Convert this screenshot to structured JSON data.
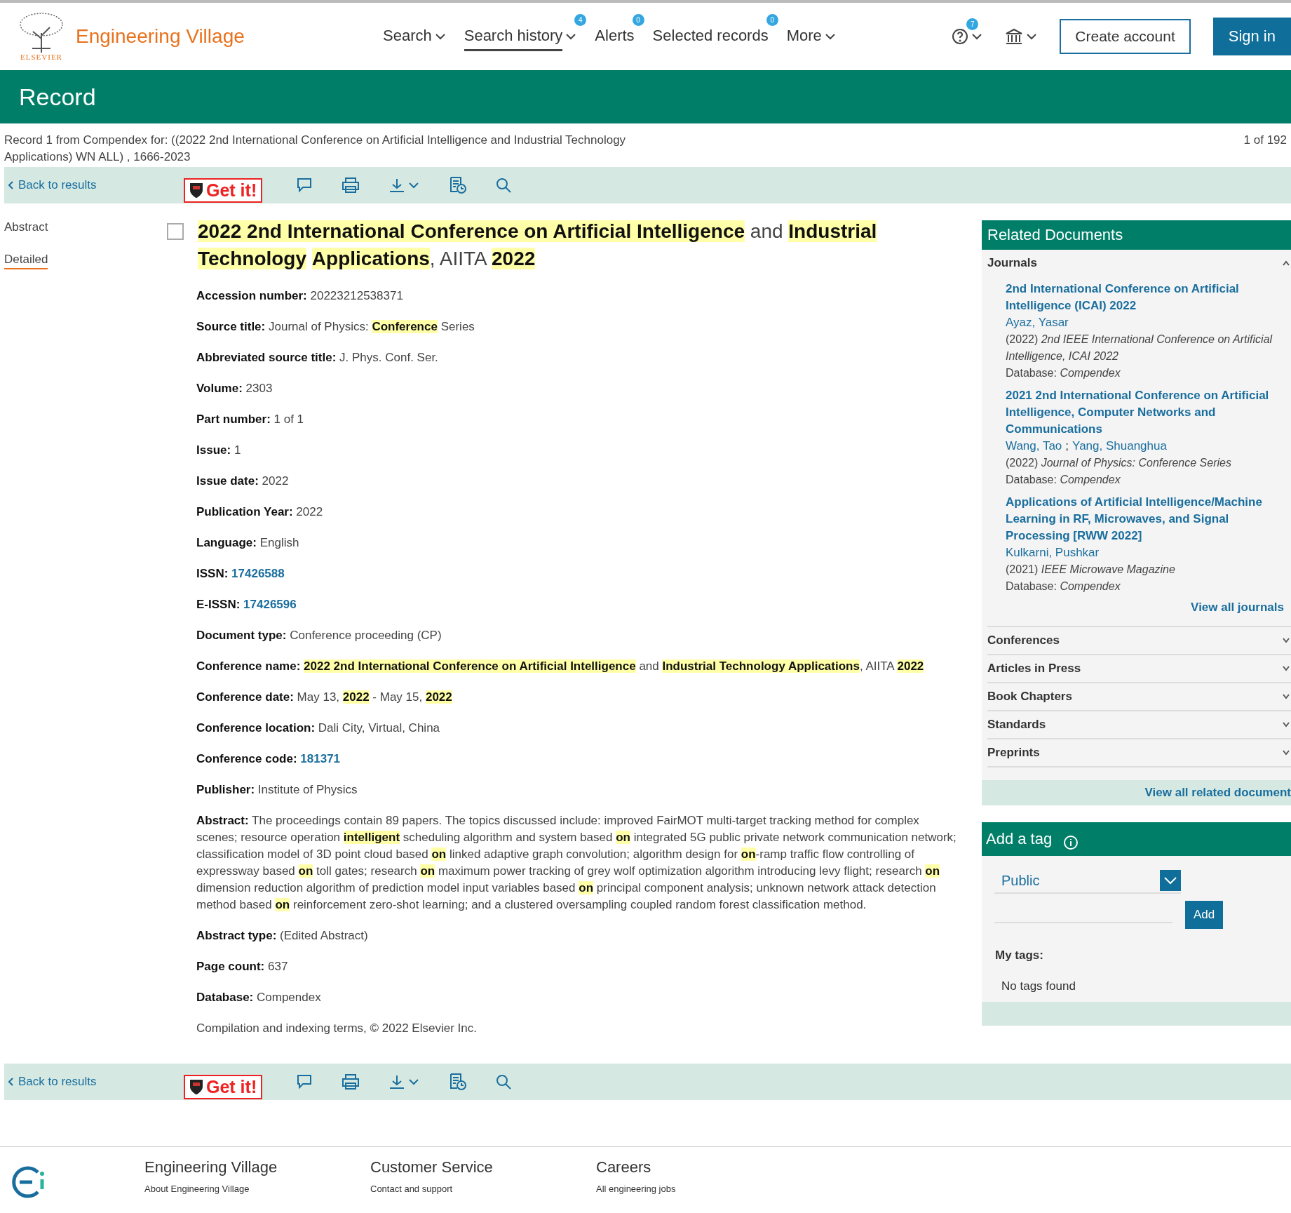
{
  "header": {
    "brand": "Engineering Village",
    "publisher": "ELSEVIER",
    "nav": [
      {
        "label": "Search",
        "caret": true,
        "selected": false
      },
      {
        "label": "Search history",
        "caret": true,
        "badge": "4",
        "selected": true
      },
      {
        "label": "Alerts",
        "caret": false,
        "badge": "0",
        "selected": false
      },
      {
        "label": "Selected records",
        "caret": false,
        "badge": "0",
        "selected": false
      },
      {
        "label": "More",
        "caret": true,
        "selected": false
      }
    ],
    "help_badge": "7",
    "create_account": "Create account",
    "sign_in": "Sign in"
  },
  "page_title": "Record",
  "record_info": {
    "text": "Record 1 from Compendex for: ((2022 2nd International Conference on Artificial Intelligence and Industrial Technology Applications) WN ALL) , 1666-2023",
    "counter": "1 of 192"
  },
  "toolbars": [
    {
      "back": "Back to results",
      "get_it": "Get it!"
    },
    {
      "back": "Back to results",
      "get_it": "Get it!"
    }
  ],
  "side_nav": [
    {
      "label": "Abstract",
      "selected": false
    },
    {
      "label": "Detailed",
      "selected": true
    }
  ],
  "record": {
    "checked": false,
    "title": "**2022 2nd International Conference on Artificial Intelligence** and **Industrial** **Technology** **Applications**, AIITA **2022**",
    "fields": [
      {
        "kind": "text",
        "label": "Accession number:",
        "value": "20223212538371"
      },
      {
        "kind": "text",
        "label": "Source title:",
        "value": "Journal of Physics: **Conference** Series"
      },
      {
        "kind": "text",
        "label": "Abbreviated source title:",
        "value": "J. Phys. Conf. Ser."
      },
      {
        "kind": "text",
        "label": "Volume:",
        "value": "2303"
      },
      {
        "kind": "text",
        "label": "Part number:",
        "value": "1 of 1"
      },
      {
        "kind": "text",
        "label": "Issue:",
        "value": "1"
      },
      {
        "kind": "text",
        "label": "Issue date:",
        "value": "2022"
      },
      {
        "kind": "text",
        "label": "Publication Year:",
        "value": "2022"
      },
      {
        "kind": "text",
        "label": "Language:",
        "value": "English"
      },
      {
        "kind": "link",
        "label": "ISSN:",
        "value": "17426588"
      },
      {
        "kind": "link",
        "label": "E-ISSN:",
        "value": "17426596"
      },
      {
        "kind": "text",
        "label": "Document type:",
        "value": "Conference proceeding (CP)"
      },
      {
        "kind": "text",
        "label": "Conference name:",
        "value": "**2022 2nd International Conference on Artificial Intelligence** and **Industrial Technology Applications**, AIITA **2022**"
      },
      {
        "kind": "text",
        "label": "Conference date:",
        "value": "May 13, **2022** - May 15, **2022**"
      },
      {
        "kind": "text",
        "label": "Conference location:",
        "value": "Dali City, Virtual, China"
      },
      {
        "kind": "link",
        "label": "Conference code:",
        "value": "181371"
      },
      {
        "kind": "text",
        "label": "Publisher:",
        "value": "Institute of Physics"
      },
      {
        "kind": "text",
        "label": "Abstract:",
        "value": "The proceedings contain 89 papers. The topics discussed include: improved FairMOT multi-target tracking method for complex scenes; resource operation **intelligent** scheduling algorithm and system based **on** integrated 5G public private network communication network; classification model of 3D point cloud based **on** linked adaptive graph convolution; algorithm design for **on**-ramp traffic flow controlling of expressway based **on** toll gates; research **on** maximum power tracking of grey wolf optimization algorithm introducing levy flight; research **on** dimension reduction algorithm of prediction model input variables based **on** principal component analysis; unknown network attack detection method based **on** reinforcement zero-shot learning; and a clustered oversampling coupled random forest classification method."
      },
      {
        "kind": "text",
        "label": "Abstract type:",
        "value": "(Edited Abstract)"
      },
      {
        "kind": "text",
        "label": "Page count:",
        "value": "637"
      },
      {
        "kind": "text",
        "label": "Database:",
        "value": "Compendex"
      },
      {
        "kind": "note",
        "value": "Compilation and indexing terms, © 2022 Elsevier Inc."
      }
    ]
  },
  "related": {
    "title": "Related Documents",
    "sections": [
      {
        "label": "Journals",
        "expanded": true,
        "items": [
          {
            "title": "2nd International Conference on Artificial Intelligence (ICAI) 2022",
            "authors": [
              "Ayaz, Yasar"
            ],
            "year": "(2022)",
            "source": "2nd IEEE International Conference on Artificial Intelligence, ICAI 2022",
            "db_label": "Database:",
            "db": "Compendex"
          },
          {
            "title": "2021 2nd International Conference on Artificial Intelligence, Computer Networks and Communications",
            "authors": [
              "Wang, Tao",
              "Yang, Shuanghua"
            ],
            "author_separator": ";",
            "year": "(2022)",
            "source": "Journal of Physics: Conference Series",
            "db_label": "Database:",
            "db": "Compendex"
          },
          {
            "title": "Applications of Artificial Intelligence/Machine Learning in RF, Microwaves, and Signal Processing [RWW 2022]",
            "authors": [
              "Kulkarni, Pushkar"
            ],
            "year": "(2021)",
            "source": "IEEE Microwave Magazine",
            "db_label": "Database:",
            "db": "Compendex"
          }
        ],
        "view_all": "View all journals"
      },
      {
        "label": "Conferences",
        "expanded": false
      },
      {
        "label": "Articles in Press",
        "expanded": false
      },
      {
        "label": "Book Chapters",
        "expanded": false
      },
      {
        "label": "Standards",
        "expanded": false
      },
      {
        "label": "Preprints",
        "expanded": false
      }
    ],
    "view_all": "View all related document"
  },
  "tag": {
    "title": "Add a tag",
    "visibility": "Public",
    "add": "Add",
    "my_tags": "My tags:",
    "empty": "No tags found"
  },
  "footer": [
    {
      "heading": "Engineering Village",
      "link": "About Engineering Village"
    },
    {
      "heading": "Customer Service",
      "link": "Contact and support"
    },
    {
      "heading": "Careers",
      "link": "All engineering jobs"
    }
  ]
}
